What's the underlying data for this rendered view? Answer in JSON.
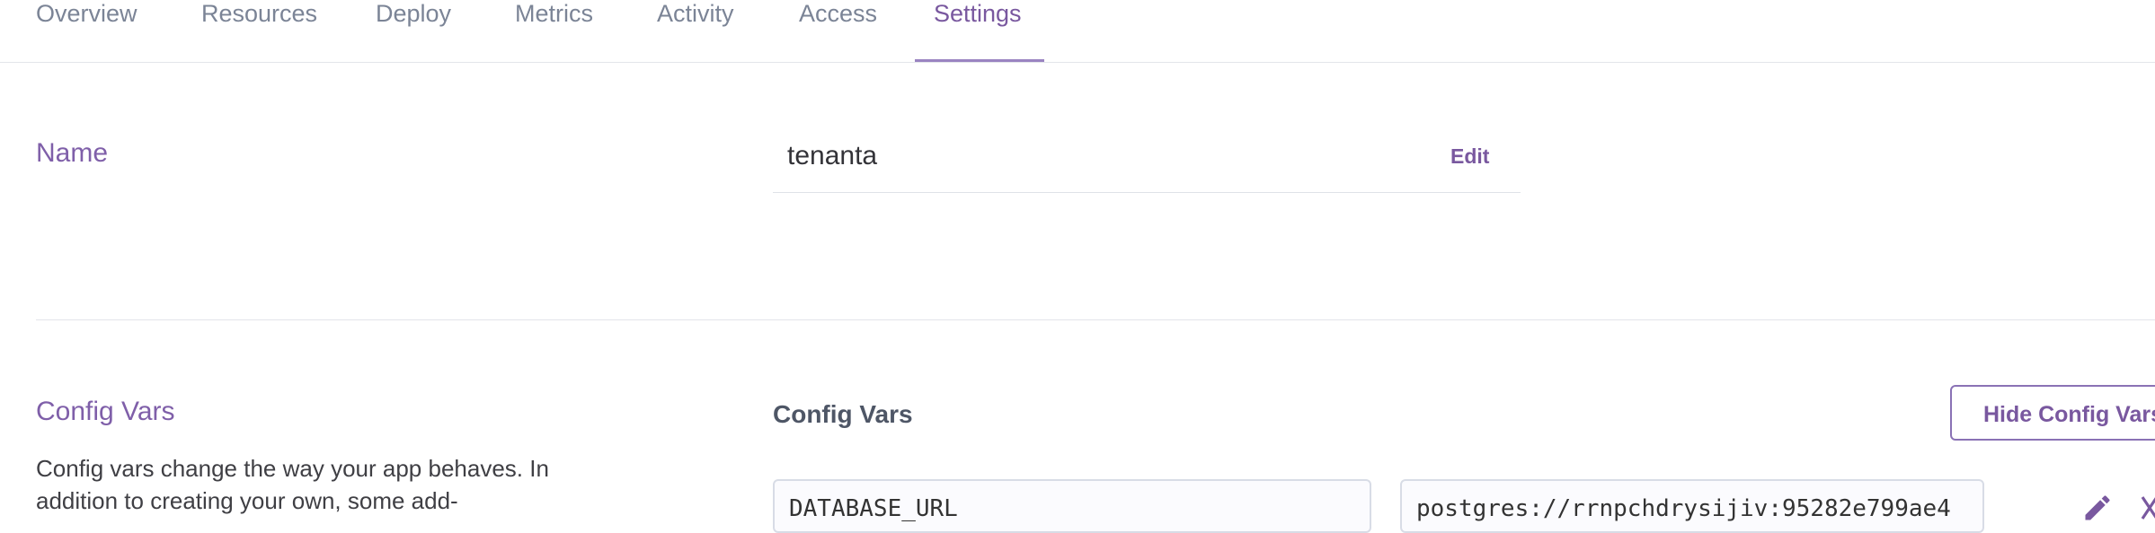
{
  "tabs": {
    "items": [
      "Overview",
      "Resources",
      "Deploy",
      "Metrics",
      "Activity",
      "Access",
      "Settings"
    ],
    "active": "Settings"
  },
  "name_section": {
    "title": "Name",
    "value": "tenanta",
    "edit_label": "Edit"
  },
  "config_section": {
    "title": "Config Vars",
    "description": "Config vars change the way your app behaves. In addition to creating your own, some add-",
    "heading": "Config Vars",
    "hide_button_label": "Hide Config Vars",
    "var_key": "DATABASE_URL",
    "var_value": "postgres://rrnpchdrysijiv:95282e799ae4"
  },
  "colors": {
    "accent": "#79589f",
    "tab_text": "#7b8496",
    "divider": "#e3e5ea"
  }
}
